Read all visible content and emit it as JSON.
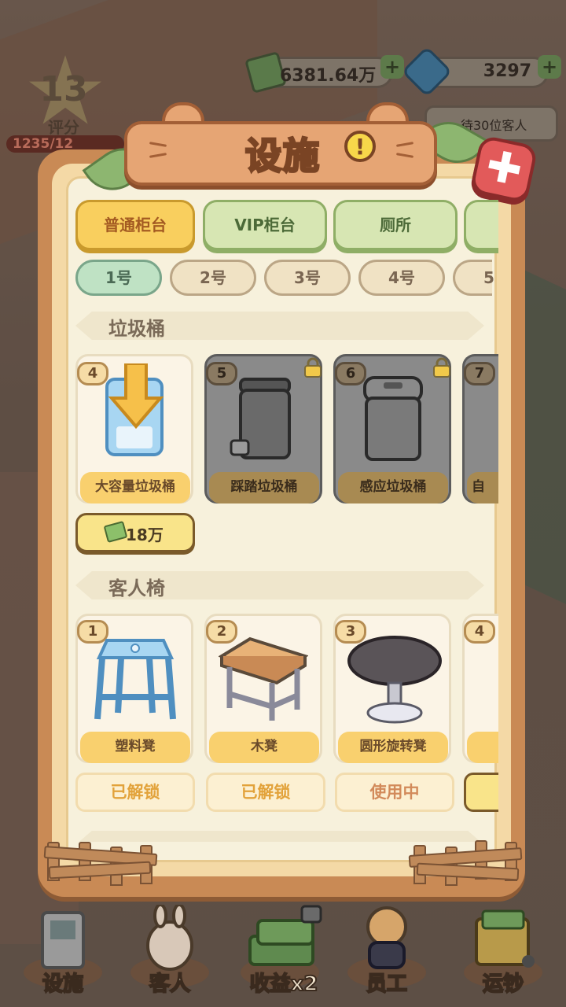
{
  "hud": {
    "level": "13",
    "rating_label": "评分",
    "rating_progress": "1235/12",
    "money": "6381.64万",
    "gems": "3297",
    "waiting_customers": "待30位客人"
  },
  "modal": {
    "title": "设施",
    "info_icon_symbol": "!",
    "close_icon_symbol": "✚",
    "tabs": [
      {
        "label": "普通柜台",
        "active": true
      },
      {
        "label": "VIP柜台",
        "active": false
      },
      {
        "label": "厕所",
        "active": false
      },
      {
        "label": "",
        "active": false
      }
    ],
    "numbers": [
      {
        "label": "1号",
        "active": true
      },
      {
        "label": "2号",
        "active": false
      },
      {
        "label": "3号",
        "active": false
      },
      {
        "label": "4号",
        "active": false
      },
      {
        "label": "5",
        "active": false
      }
    ],
    "trash_section": {
      "title": "垃圾桶",
      "items": [
        {
          "level": "4",
          "name": "大容量垃圾桶",
          "locked": false,
          "icon": "bin-with-arrow-icon"
        },
        {
          "level": "5",
          "name": "踩踏垃圾桶",
          "locked": true,
          "icon": "pedal-bin-icon"
        },
        {
          "level": "6",
          "name": "感应垃圾桶",
          "locked": true,
          "icon": "sensor-bin-icon"
        },
        {
          "level": "7",
          "name": "自",
          "locked": true,
          "icon": "bin-icon"
        }
      ],
      "price": "18万"
    },
    "chair_section": {
      "title": "客人椅",
      "items": [
        {
          "level": "1",
          "name": "塑料凳",
          "state": "已解锁",
          "icon": "plastic-stool-icon"
        },
        {
          "level": "2",
          "name": "木凳",
          "state": "已解锁",
          "icon": "wood-stool-icon"
        },
        {
          "level": "3",
          "name": "圆形旋转凳",
          "state": "使用中",
          "icon": "swivel-stool-icon"
        },
        {
          "level": "4",
          "name": "",
          "state": "",
          "icon": "stool-icon"
        }
      ]
    }
  },
  "bottom_nav": [
    {
      "label": "设施",
      "icon": "facility-icon"
    },
    {
      "label": "客人",
      "icon": "customer-icon"
    },
    {
      "label": "收益x2",
      "icon": "money-stack-icon"
    },
    {
      "label": "员工",
      "icon": "staff-icon"
    },
    {
      "label": "运钞",
      "icon": "cash-cart-icon"
    }
  ],
  "colors": {
    "active_tab": "#f9cf5e",
    "inactive_tab": "#d7e6b3",
    "panel": "#c98a55",
    "close": "#e25a5a"
  }
}
